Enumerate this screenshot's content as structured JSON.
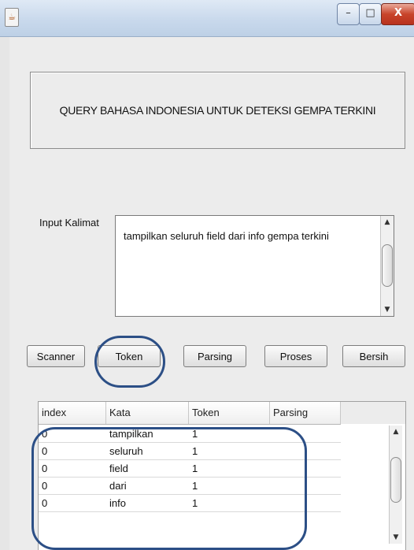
{
  "window": {
    "icon": "java-app-icon",
    "controls": {
      "minimize": "–",
      "maximize": "□",
      "close": "X"
    }
  },
  "header": {
    "title": "QUERY BAHASA INDONESIA UNTUK DETEKSI GEMPA TERKINI"
  },
  "input": {
    "label": "Input Kalimat",
    "value": "tampilkan seluruh field dari info gempa terkini"
  },
  "buttons": [
    {
      "label": "Scanner"
    },
    {
      "label": "Token"
    },
    {
      "label": "Parsing"
    },
    {
      "label": "Proses"
    },
    {
      "label": "Bersih"
    }
  ],
  "table": {
    "columns": [
      "index",
      "Kata",
      "Token",
      "Parsing"
    ],
    "rows": [
      [
        "0",
        "tampilkan",
        "1",
        ""
      ],
      [
        "0",
        "seluruh",
        "1",
        ""
      ],
      [
        "0",
        "field",
        "1",
        ""
      ],
      [
        "0",
        "dari",
        "1",
        ""
      ],
      [
        "0",
        "info",
        "1",
        ""
      ]
    ]
  },
  "annotation_color": "#2c4f86",
  "scroll_arrows": {
    "up": "▲",
    "down": "▼"
  }
}
